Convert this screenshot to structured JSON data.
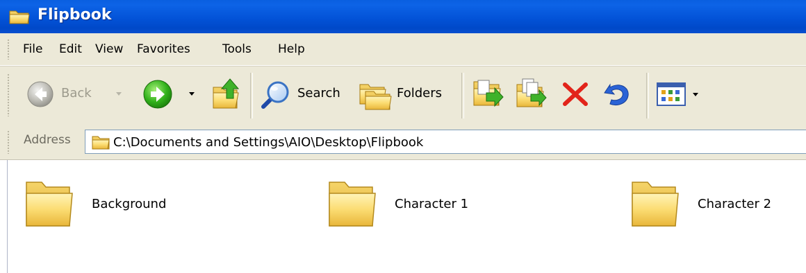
{
  "window": {
    "title": "Flipbook",
    "title_icon": "folder-icon",
    "accent_color": "#0a5fe0"
  },
  "menubar": {
    "items": [
      "File",
      "Edit",
      "View",
      "Favorites",
      "Tools",
      "Help"
    ]
  },
  "toolbar": {
    "back_label": "Back",
    "back_icon": "back-arrow-icon",
    "forward_icon": "forward-arrow-icon",
    "up_icon": "folder-up-icon",
    "search_label": "Search",
    "search_icon": "search-icon",
    "folders_label": "Folders",
    "folders_icon": "folders-icon",
    "move_to_icon": "move-to-icon",
    "copy_to_icon": "copy-to-icon",
    "delete_icon": "delete-icon",
    "undo_icon": "undo-icon",
    "views_icon": "views-icon"
  },
  "address": {
    "label": "Address",
    "value": "C:\\Documents and Settings\\AIO\\Desktop\\Flipbook"
  },
  "content": {
    "folders": [
      {
        "name": "Background",
        "icon": "folder-icon"
      },
      {
        "name": "Character 1",
        "icon": "folder-icon"
      },
      {
        "name": "Character 2",
        "icon": "folder-icon"
      }
    ]
  }
}
